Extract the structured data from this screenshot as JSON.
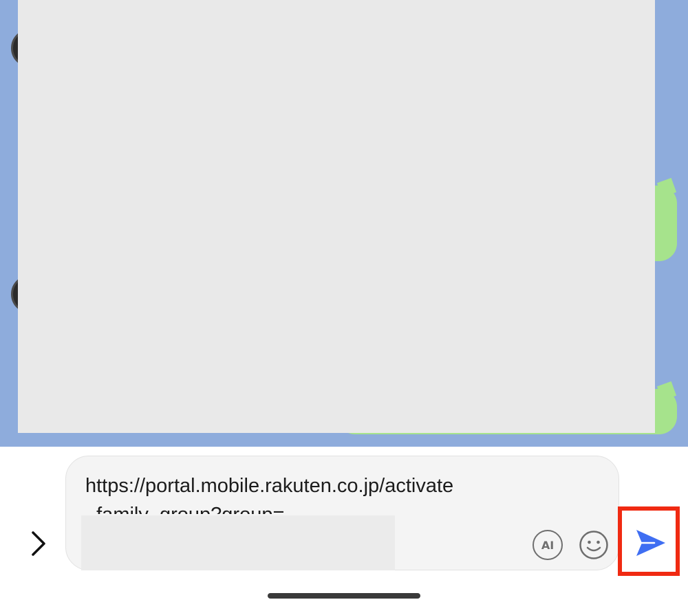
{
  "composer": {
    "message_line1": "https://portal.mobile.rakuten.co.jp/activate",
    "message_line2": "_family_group?group="
  },
  "buttons": {
    "ai_label": "AI"
  },
  "icons": {
    "expand": "chevron-right-icon",
    "emoji": "smiley-icon",
    "send": "paper-plane-icon"
  },
  "colors": {
    "chat_background": "#8eacdc",
    "own_bubble": "#a6e38c",
    "send_accent": "#3f6ef2",
    "highlight_box": "#f02a12"
  }
}
